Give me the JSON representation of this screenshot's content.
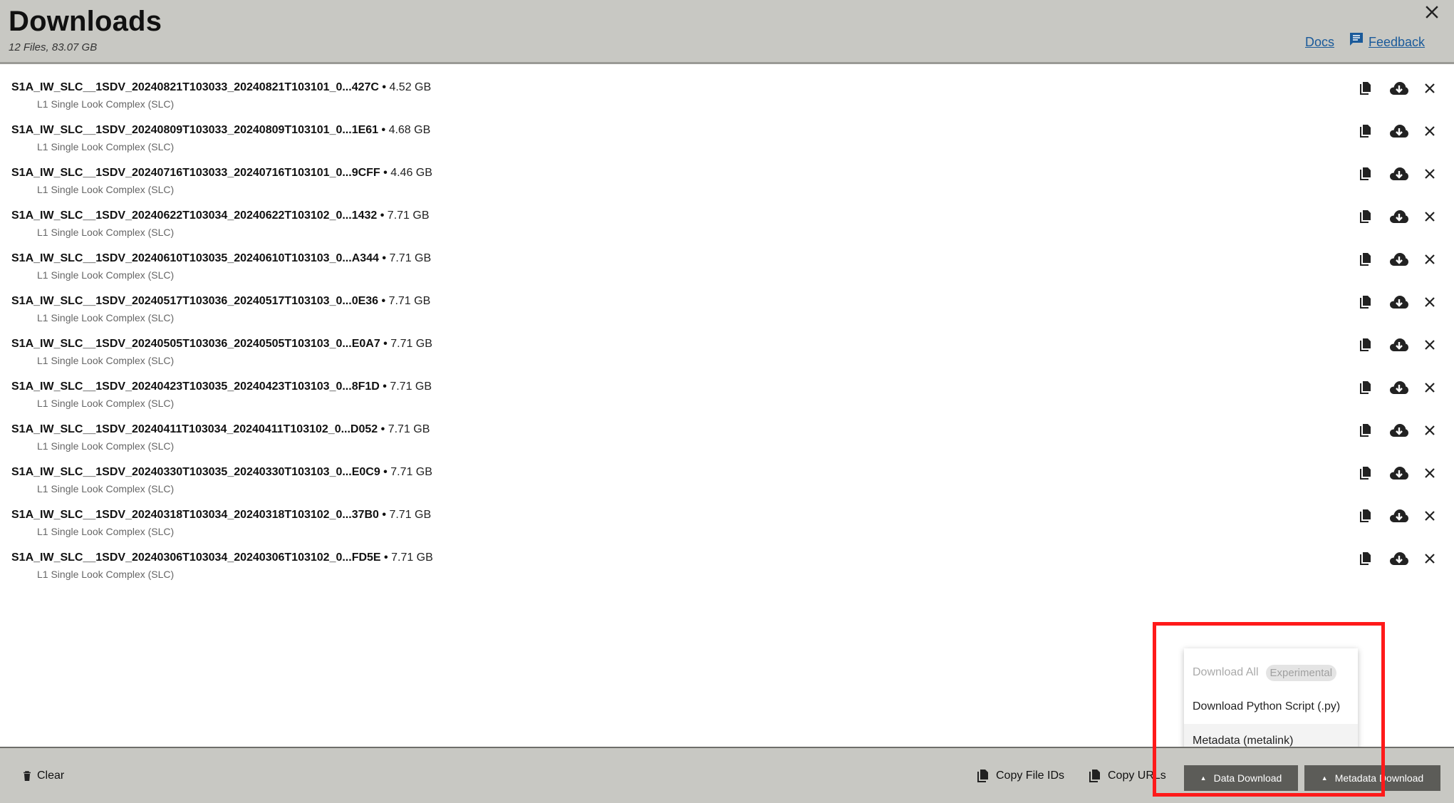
{
  "header": {
    "title": "Downloads",
    "subtitle": "12 Files, 83.07 GB",
    "docs_label": "Docs",
    "feedback_label": "Feedback"
  },
  "files": [
    {
      "name": "S1A_IW_SLC__1SDV_20240821T103033_20240821T103101_0...427C",
      "size": "4.52 GB",
      "type": "L1 Single Look Complex (SLC)"
    },
    {
      "name": "S1A_IW_SLC__1SDV_20240809T103033_20240809T103101_0...1E61",
      "size": "4.68 GB",
      "type": "L1 Single Look Complex (SLC)"
    },
    {
      "name": "S1A_IW_SLC__1SDV_20240716T103033_20240716T103101_0...9CFF",
      "size": "4.46 GB",
      "type": "L1 Single Look Complex (SLC)"
    },
    {
      "name": "S1A_IW_SLC__1SDV_20240622T103034_20240622T103102_0...1432",
      "size": "7.71 GB",
      "type": "L1 Single Look Complex (SLC)"
    },
    {
      "name": "S1A_IW_SLC__1SDV_20240610T103035_20240610T103103_0...A344",
      "size": "7.71 GB",
      "type": "L1 Single Look Complex (SLC)"
    },
    {
      "name": "S1A_IW_SLC__1SDV_20240517T103036_20240517T103103_0...0E36",
      "size": "7.71 GB",
      "type": "L1 Single Look Complex (SLC)"
    },
    {
      "name": "S1A_IW_SLC__1SDV_20240505T103036_20240505T103103_0...E0A7",
      "size": "7.71 GB",
      "type": "L1 Single Look Complex (SLC)"
    },
    {
      "name": "S1A_IW_SLC__1SDV_20240423T103035_20240423T103103_0...8F1D",
      "size": "7.71 GB",
      "type": "L1 Single Look Complex (SLC)"
    },
    {
      "name": "S1A_IW_SLC__1SDV_20240411T103034_20240411T103102_0...D052",
      "size": "7.71 GB",
      "type": "L1 Single Look Complex (SLC)"
    },
    {
      "name": "S1A_IW_SLC__1SDV_20240330T103035_20240330T103103_0...E0C9",
      "size": "7.71 GB",
      "type": "L1 Single Look Complex (SLC)"
    },
    {
      "name": "S1A_IW_SLC__1SDV_20240318T103034_20240318T103102_0...37B0",
      "size": "7.71 GB",
      "type": "L1 Single Look Complex (SLC)"
    },
    {
      "name": "S1A_IW_SLC__1SDV_20240306T103034_20240306T103102_0...FD5E",
      "size": "7.71 GB",
      "type": "L1 Single Look Complex (SLC)"
    }
  ],
  "menu": {
    "download_all_label": "Download All",
    "experimental_badge": "Experimental",
    "python_script_label": "Download Python Script (.py)",
    "metalink_label": "Metadata (metalink)"
  },
  "footer": {
    "clear_label": "Clear",
    "copy_ids_label": "Copy File IDs",
    "copy_urls_label": "Copy URLs",
    "data_download_label": "Data Download",
    "metadata_download_label": "Metadata Download"
  },
  "colors": {
    "header_bg": "#c8c8c3",
    "link": "#1a5a9a",
    "button_bg": "#5c5c58",
    "highlight": "#ff1a1a"
  }
}
